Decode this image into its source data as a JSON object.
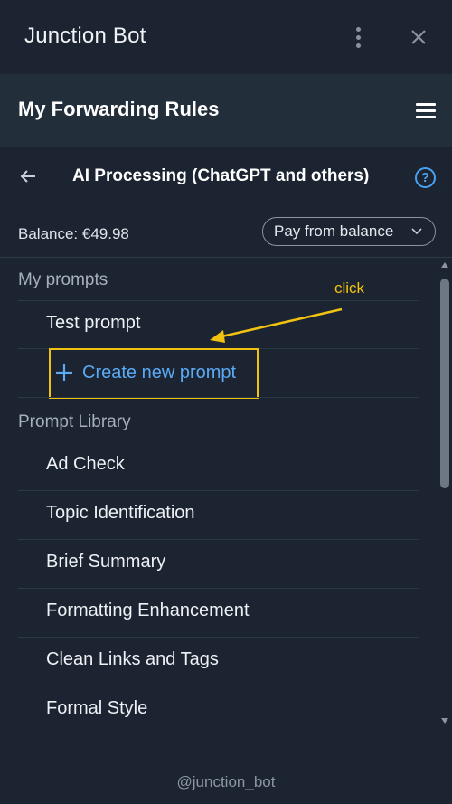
{
  "window": {
    "title": "Junction Bot",
    "menu_icon": "kebab-menu-icon",
    "close_icon": "close-icon"
  },
  "header": {
    "title": "My Forwarding Rules",
    "menu_icon": "hamburger-menu-icon"
  },
  "subheader": {
    "back_icon": "arrow-left-icon",
    "title": "AI Processing (ChatGPT and others)",
    "help_label": "?"
  },
  "balance": {
    "label": "Balance: €49.98",
    "payment_select": "Pay from balance"
  },
  "my_prompts": {
    "label": "My prompts",
    "items": [
      "Test prompt"
    ],
    "create_label": "Create new prompt"
  },
  "annotation": {
    "text": "click",
    "color": "#f2c211"
  },
  "prompt_library": {
    "label": "Prompt Library",
    "items": [
      "Ad Check",
      "Topic Identification",
      "Brief Summary",
      "Formatting Enhancement",
      "Clean Links and Tags",
      "Formal Style"
    ]
  },
  "footer": {
    "text": "@junction_bot"
  },
  "colors": {
    "background": "#1b2430",
    "header_bg": "#232e3b",
    "accent_blue": "#5aaaf5",
    "highlight_yellow": "#f2c211"
  }
}
